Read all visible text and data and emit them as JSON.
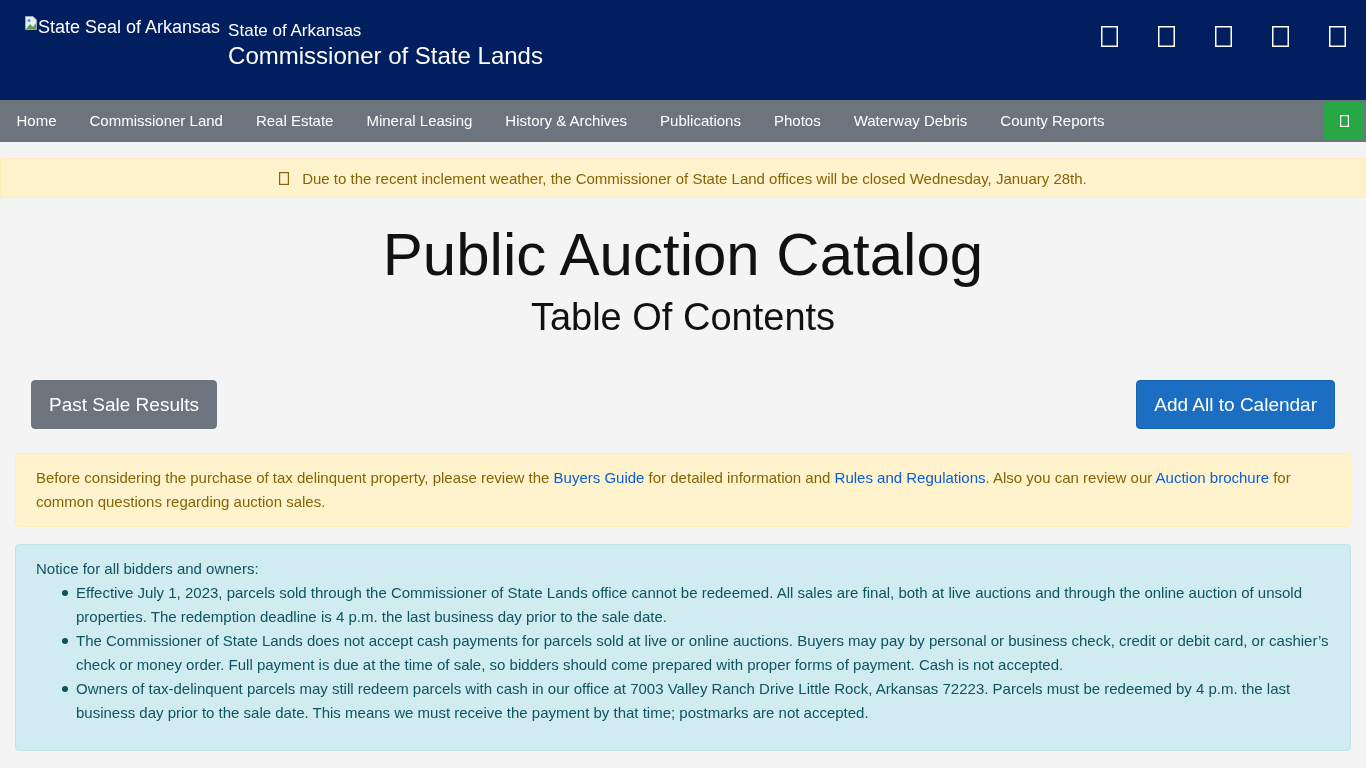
{
  "header": {
    "logo_alt_text": "State Seal of Arkansas",
    "subtitle": "State of Arkansas",
    "title": "Commissioner of State Lands"
  },
  "nav": {
    "items": [
      "Home",
      "Commissioner Land",
      "Real Estate",
      "Mineral Leasing",
      "History & Archives",
      "Publications",
      "Photos",
      "Waterway Debris",
      "County Reports"
    ]
  },
  "alert_banner": {
    "text": "Due to the recent inclement weather, the Commissioner of State Land offices will be closed Wednesday, January 28th."
  },
  "page_heading": {
    "title": "Public Auction Catalog",
    "subtitle": "Table Of Contents"
  },
  "actions": [
    {
      "label": "Past Sale Results",
      "kind": "secondary"
    },
    {
      "label": "Add All to Calendar",
      "kind": "primary"
    }
  ],
  "buyer_notice": {
    "segments": [
      {
        "kind": "text",
        "text": "Before considering the purchase of tax delinquent property, please review the "
      },
      {
        "kind": "link",
        "text": "Buyers Guide"
      },
      {
        "kind": "text",
        "text": " for detailed information and "
      },
      {
        "kind": "link",
        "text": "Rules and Regulations"
      },
      {
        "kind": "text",
        "text": ". Also you can review our "
      },
      {
        "kind": "link",
        "text": "Auction brochure"
      },
      {
        "kind": "text",
        "text": " for common questions regarding auction sales."
      }
    ]
  },
  "bidder_notice": {
    "heading": "Notice for all bidders and owners:",
    "items": [
      "Effective July 1, 2023, parcels sold through the Commissioner of State Lands office cannot be redeemed. All sales are final, both at live auctions and through the online auction of unsold properties. The redemption deadline is 4 p.m. the last business day prior to the sale date.",
      "The Commissioner of State Lands does not accept cash payments for parcels sold at live or online auctions. Buyers may pay by personal or business check, credit or debit card, or cashier’s check or money order. Full payment is due at the time of sale, so bidders should come prepared with proper forms of payment. Cash is not accepted.",
      "Owners of tax-delinquent parcels may still redeem parcels with cash in our office at 7003 Valley Ranch Drive Little Rock, Arkansas 72223. Parcels must be redeemed by 4 p.m. the last business day prior to the sale date. This means we must receive the payment by that time; postmarks are not accepted."
    ]
  }
}
